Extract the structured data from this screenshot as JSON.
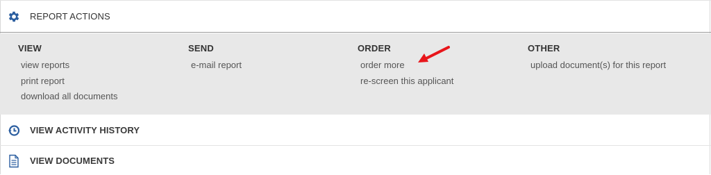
{
  "report_actions": {
    "title": "REPORT ACTIONS",
    "icon": "gear-icon",
    "accent": "#2a5d9f",
    "columns": [
      {
        "title": "VIEW",
        "items": [
          "view reports",
          "print report",
          "download all documents"
        ]
      },
      {
        "title": "SEND",
        "items": [
          "e-mail report"
        ]
      },
      {
        "title": "ORDER",
        "items": [
          "order more",
          "re-screen this applicant"
        ]
      },
      {
        "title": "OTHER",
        "items": [
          "upload document(s) for this report"
        ]
      }
    ]
  },
  "activity_history": {
    "title": "VIEW ACTIVITY HISTORY",
    "icon": "history-icon"
  },
  "documents": {
    "title": "VIEW DOCUMENTS",
    "icon": "document-icon"
  },
  "annotation": {
    "arrow_color": "#e8161b"
  }
}
